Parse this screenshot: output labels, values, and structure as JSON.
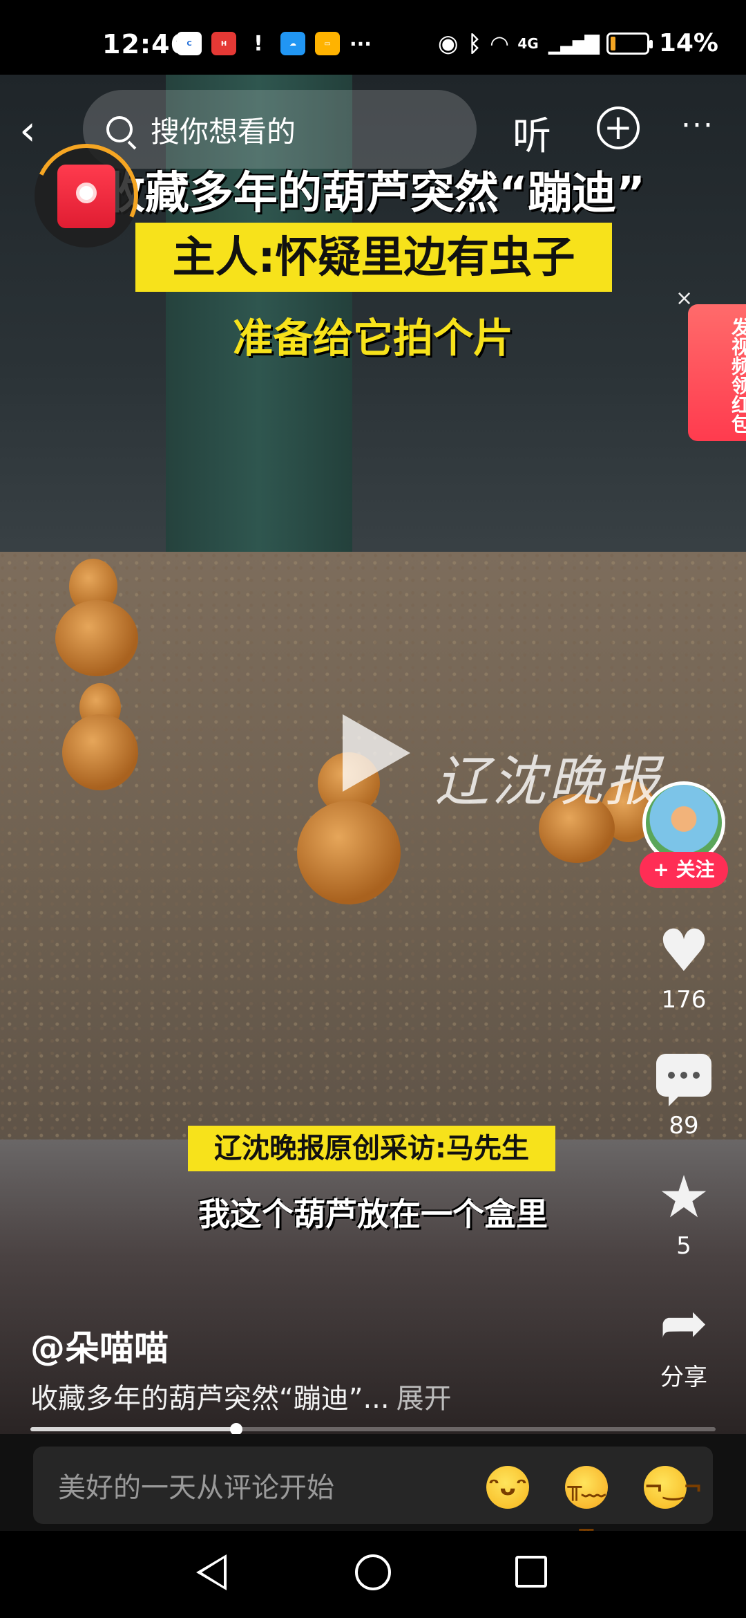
{
  "status_bar": {
    "time": "12:46",
    "network": "4G",
    "battery_percent": "14%",
    "battery_level": 0.14,
    "app_icons": [
      "browser-icon",
      "huawei-store-icon",
      "alert-icon",
      "weather-icon",
      "notes-icon"
    ],
    "overflow": "···"
  },
  "top_bar": {
    "back_label": "‹",
    "search_placeholder": "搜你想看的",
    "listen_label": "听",
    "add_label": "+",
    "more_label": "···"
  },
  "video": {
    "caption_title": "收藏多年的葫芦突然“蹦迪”",
    "caption_sub1": "主人:怀疑里边有虫子",
    "caption_sub2": "准备给它拍个片",
    "caption_credit": "辽沈晚报原创采访:马先生",
    "caption_speech": "我这个葫芦放在一个盒里",
    "watermark": "辽沈晚报"
  },
  "promo": {
    "label": "发视频领红包",
    "close": "×"
  },
  "actions": {
    "follow_label": "+ 关注",
    "like_count": "176",
    "comment_count": "89",
    "favorite_count": "5",
    "share_label": "分享"
  },
  "info": {
    "author": "@朵喵喵",
    "description": "收藏多年的葫芦突然“蹦迪”...",
    "expand_label": "展开",
    "progress": 0.3
  },
  "comment_bar": {
    "placeholder": "美好的一天从评论开始",
    "emojis": [
      "laughing-emoji",
      "crying-emoji",
      "smirk-emoji"
    ]
  },
  "colors": {
    "follow_red": "#ff2d55",
    "caption_yellow": "#f7e21b",
    "battery_low": "#f5a623"
  }
}
